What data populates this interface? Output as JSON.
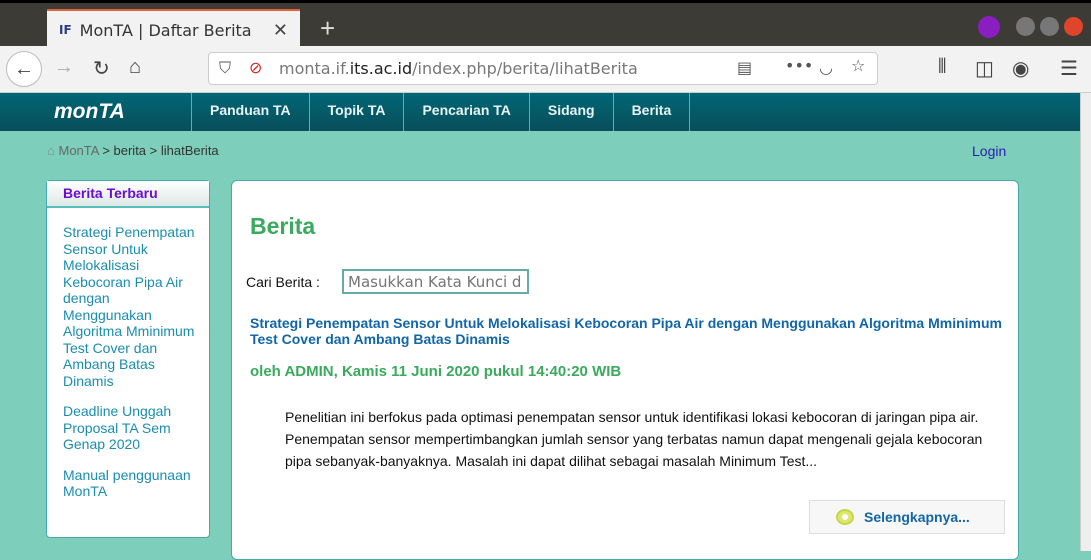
{
  "browser": {
    "tab_title": "MonTA | Daftar Berita",
    "tab_favicon": "IF",
    "url_pre": "monta.if.",
    "url_domain": "its.ac.id",
    "url_post": "/index.php/berita/lihatBerita"
  },
  "nav": {
    "logo": "monTA",
    "items": [
      "Panduan TA",
      "Topik TA",
      "Pencarian TA",
      "Sidang",
      "Berita"
    ]
  },
  "breadcrumb": {
    "home": "MonTA",
    "rest": " > berita > lihatBerita"
  },
  "login": "Login",
  "sidebar": {
    "title": "Berita Terbaru",
    "items": [
      "Strategi Penempatan Sensor Untuk Melokalisasi Kebocoran Pipa Air dengan Menggunakan Algoritma Mminimum Test Cover dan Ambang Batas Dinamis",
      "Deadline Unggah Proposal TA Sem Genap 2020",
      "Manual penggunaan MonTA"
    ]
  },
  "main": {
    "title": "Berita",
    "search_label": "Cari Berita :",
    "search_placeholder": "Masukkan Kata Kunci d",
    "article": {
      "title": "Strategi Penempatan Sensor Untuk Melokalisasi Kebocoran Pipa Air dengan Menggunakan Algoritma Mminimum Test Cover dan Ambang Batas Dinamis",
      "meta": "oleh ADMIN, Kamis 11 Juni 2020 pukul 14:40:20 WIB",
      "excerpt": "Penelitian ini berfokus pada optimasi penempatan sensor untuk identifikasi lokasi kebocoran di jaringan pipa air. Penempatan sensor mempertimbangkan jumlah sensor yang terbatas namun dapat mengenali gejala kebocoran pipa sebanyak-banyaknya. Masalah ini dapat dilihat sebagai masalah Minimum Test...",
      "more": "Selengkapnya..."
    }
  }
}
